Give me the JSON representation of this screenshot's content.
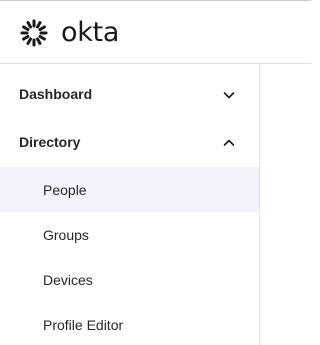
{
  "brand": {
    "wordmark": "okta",
    "logo_icon": "okta-sunburst-icon"
  },
  "sidebar": {
    "sections": [
      {
        "label": "Dashboard",
        "expanded": false,
        "chevron_icon": "chevron-down-icon"
      },
      {
        "label": "Directory",
        "expanded": true,
        "chevron_icon": "chevron-up-icon",
        "items": [
          {
            "label": "People",
            "active": true
          },
          {
            "label": "Groups",
            "active": false
          },
          {
            "label": "Devices",
            "active": false
          },
          {
            "label": "Profile Editor",
            "active": false
          }
        ]
      }
    ]
  },
  "colors": {
    "active_item_bg": "#f2f3fd",
    "divider": "#e1e2e6",
    "text": "#272727"
  }
}
